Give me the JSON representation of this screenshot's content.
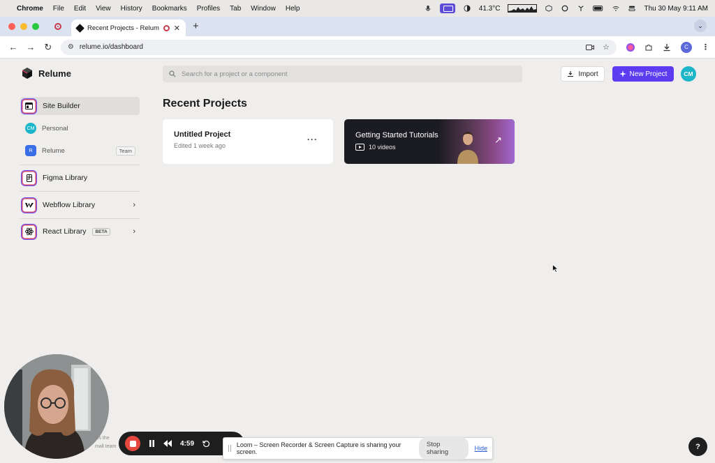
{
  "menubar": {
    "app": "Chrome",
    "items": [
      "File",
      "Edit",
      "View",
      "History",
      "Bookmarks",
      "Profiles",
      "Tab",
      "Window",
      "Help"
    ],
    "temperature": "41.3°C",
    "datetime": "Thu 30 May  9:11 AM"
  },
  "browser": {
    "tab_title": "Recent Projects - Relume",
    "url": "relume.io/dashboard",
    "profile_initial": "C"
  },
  "app": {
    "brand": "Relume",
    "search_placeholder": "Search for a project or a component",
    "import_label": "Import",
    "new_project_label": "New Project",
    "avatar_initials": "CM"
  },
  "sidebar": {
    "site_builder": "Site Builder",
    "personal": {
      "initials": "CM",
      "label": "Personal"
    },
    "relume": {
      "initials": "R",
      "label": "Relume",
      "badge": "Team"
    },
    "figma": "Figma Library",
    "webflow": "Webflow Library",
    "react": "React Library",
    "react_badge": "BETA"
  },
  "main": {
    "heading": "Recent Projects",
    "project": {
      "name": "Untitled Project",
      "meta": "Edited 1 week ago"
    },
    "tutorials": {
      "title": "Getting Started Tutorials",
      "count": "10 videos"
    }
  },
  "loom": {
    "timer": "4:59",
    "share_text": "Loom – Screen Recorder & Screen Capture is sharing your screen.",
    "stop_label": "Stop sharing",
    "hide_label": "Hide",
    "peek_1": "ins the",
    "peek_2": "mall team"
  },
  "help_label": "?",
  "colors": {
    "accent": "#5b3cf0",
    "avatar": "#1cb5c9",
    "record": "#e5483e"
  }
}
